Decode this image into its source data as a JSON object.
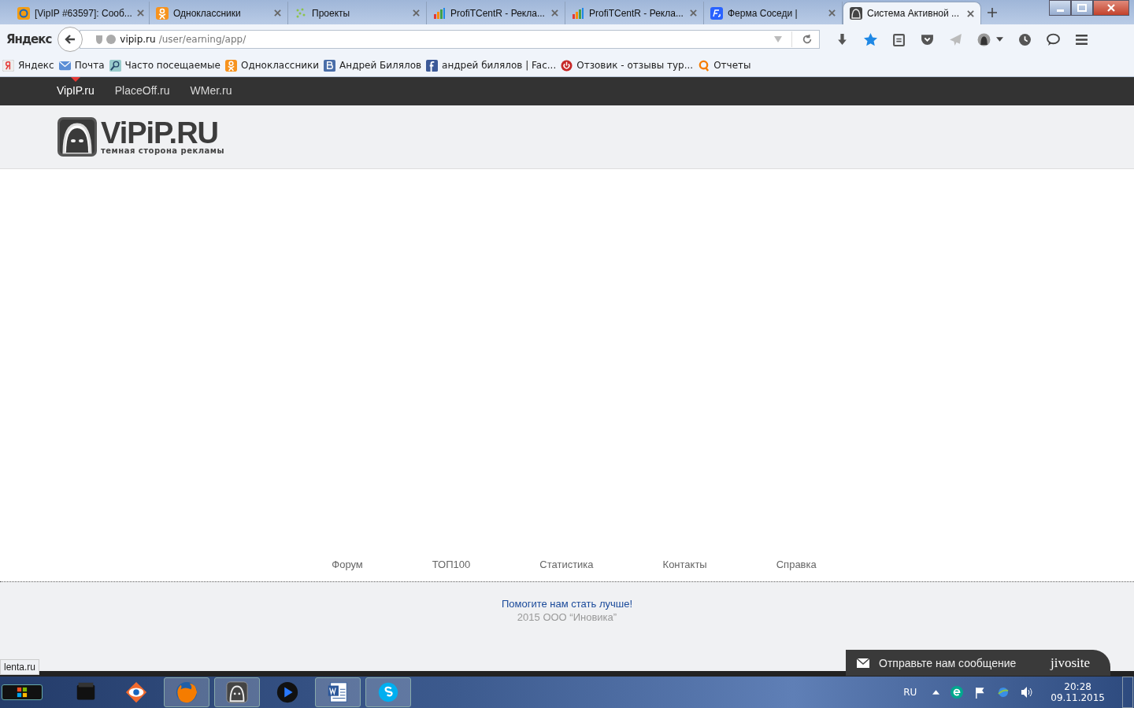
{
  "browser": {
    "tabs": [
      {
        "title": "[VipIP #63597]: Сооб...",
        "kind": "mail",
        "selected": false
      },
      {
        "title": "Одноклассники",
        "kind": "ok",
        "selected": false
      },
      {
        "title": "Проекты",
        "kind": "dots",
        "selected": false
      },
      {
        "title": "ProfiTCentR - Рекла...",
        "kind": "chart",
        "selected": false
      },
      {
        "title": "ProfiTCentR - Рекла...",
        "kind": "chart",
        "selected": false
      },
      {
        "title": "Ферма Соседи |",
        "kind": "fs",
        "selected": false
      },
      {
        "title": "Система Активной ...",
        "kind": "ghost",
        "selected": true
      }
    ],
    "search_engine": "Яндекс",
    "url_host": "vipip.ru",
    "url_path": "/user/earning/app/",
    "bookmarks": [
      {
        "label": "Яндекс",
        "kind": "ya"
      },
      {
        "label": "Почта",
        "kind": "mail"
      },
      {
        "label": "Часто посещаемые",
        "kind": "search"
      },
      {
        "label": "Одноклассники",
        "kind": "ok"
      },
      {
        "label": "Андрей Билялов",
        "kind": "vk"
      },
      {
        "label": "андрей билялов | Fac...",
        "kind": "fb"
      },
      {
        "label": "Отзовик - отзывы тур...",
        "kind": "otz"
      },
      {
        "label": "Отчеты",
        "kind": "q"
      }
    ],
    "status_text": "lenta.ru"
  },
  "site": {
    "nav": [
      {
        "label": "VipIP.ru",
        "selected": true
      },
      {
        "label": "PlaceOff.ru",
        "selected": false
      },
      {
        "label": "WMer.ru",
        "selected": false
      }
    ],
    "logo_title": "ViPiP.RU",
    "logo_tagline": "темная сторона рекламы",
    "footer_links": [
      "Форум",
      "ТОП100",
      "Статистика",
      "Контакты",
      "Справка"
    ],
    "feedback_link": "Помогите нам стать лучше!",
    "copyright": "2015 ООО “Иновика”",
    "chat": {
      "label": "Отправьте нам сообщение",
      "brand": "jivosite"
    }
  },
  "taskbar": {
    "apps": [
      {
        "kind": "folder",
        "running": false
      },
      {
        "kind": "eye",
        "running": false
      },
      {
        "kind": "firefox",
        "running": true
      },
      {
        "kind": "ghost",
        "running": true
      },
      {
        "kind": "player",
        "running": false
      },
      {
        "kind": "word",
        "running": true
      },
      {
        "kind": "skype",
        "running": true
      }
    ],
    "language": "RU",
    "time": "20:28",
    "date": "09.11.2015"
  }
}
